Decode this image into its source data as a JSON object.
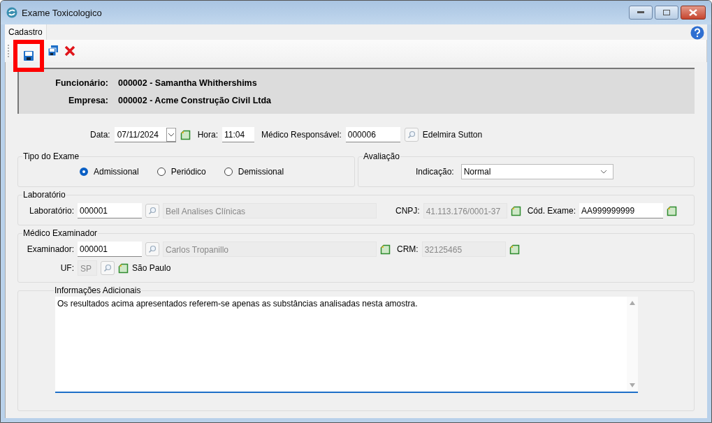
{
  "window": {
    "title": "Exame Toxicologico"
  },
  "menu": [
    {
      "label": "Cadastro",
      "selected": true
    }
  ],
  "toolbar": [
    {
      "kind": "save",
      "highlighted": true
    },
    {
      "kind": "save-copy",
      "highlighted": false
    },
    {
      "kind": "delete",
      "highlighted": false
    }
  ],
  "header": [
    {
      "label": "Funcionário:",
      "value": "000002 - Samantha Whithershims"
    },
    {
      "label": "Empresa:",
      "value": "000002 - Acme Construção Civil Ltda"
    }
  ],
  "exam_info": {
    "date_label": "Data:",
    "date": "07/11/2024",
    "time_label": "Hora:",
    "time": "11:04",
    "doctor_label": "Médico Responsável:",
    "doctor_code": "000006",
    "doctor_name": "Edelmira Sutton"
  },
  "exam_type": {
    "title": "Tipo do Exame",
    "options": [
      {
        "label": "Admissional",
        "selected": true
      },
      {
        "label": "Periódico",
        "selected": false
      },
      {
        "label": "Demissional",
        "selected": false
      }
    ]
  },
  "evaluation": {
    "title": "Avaliação",
    "label": "Indicação:",
    "value": "Normal"
  },
  "laboratory": {
    "title": "Laboratório",
    "lab_label": "Laboratório:",
    "lab_code": "000001",
    "lab_name": "Bell Analises Clínicas",
    "cnpj_label": "CNPJ:",
    "cnpj": "41.113.176/0001-37",
    "exam_code_label": "Cód. Exame:",
    "exam_code": "AA999999999"
  },
  "examiner": {
    "title": "Médico Examinador",
    "label": "Examinador:",
    "code": "000001",
    "name": "Carlos Tropanillo",
    "crm_label": "CRM:",
    "crm": "32125465",
    "uf_label": "UF:",
    "uf": "SP",
    "state_name": "São Paulo"
  },
  "additional_info": {
    "title": "Informações Adicionais",
    "text": "Os resultados acima apresentados referem-se apenas as substâncias analisadas nesta amostra."
  }
}
